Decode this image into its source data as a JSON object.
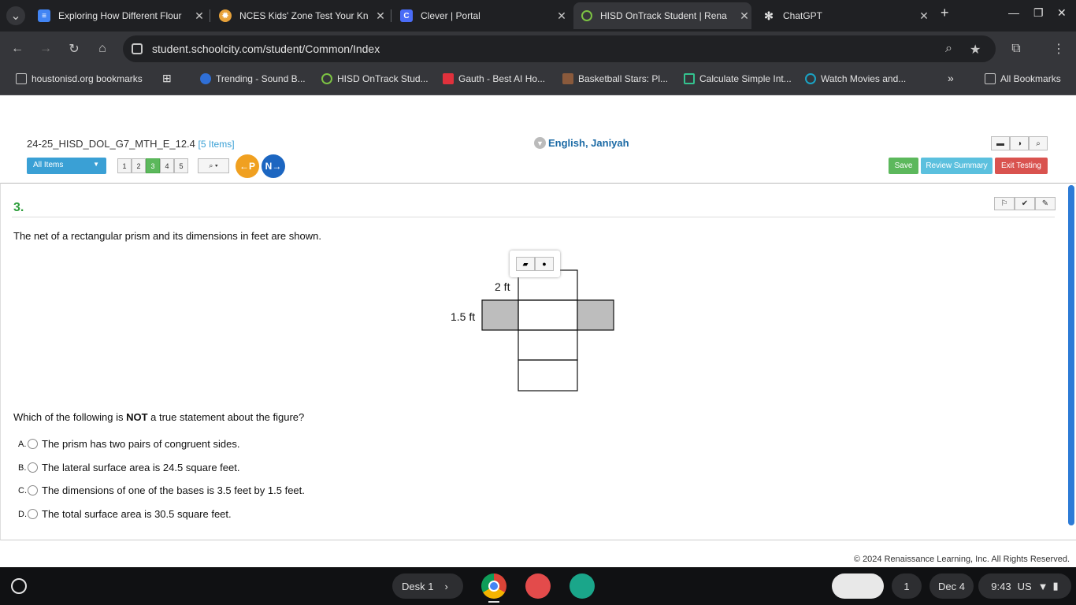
{
  "browser": {
    "tabs": [
      {
        "title": "Exploring How Different Flour",
        "icon": "google-docs-icon",
        "color": "#4285f4"
      },
      {
        "title": "NCES Kids' Zone Test Your Kn",
        "icon": "nces-sun-icon",
        "color": "#e8a23a"
      },
      {
        "title": "Clever | Portal",
        "icon": "clever-c-icon",
        "color": "#4a6cf7"
      },
      {
        "title": "HISD OnTrack Student | Rena",
        "icon": "ontrack-ring-icon",
        "color": "#7cc243"
      },
      {
        "title": "ChatGPT",
        "icon": "chatgpt-icon",
        "color": "#e3e3e3"
      }
    ],
    "active_tab_index": 3,
    "url": "student.schoolcity.com/student/Common/Index",
    "bookmarks": [
      {
        "label": "houstonisd.org bookmarks",
        "icon": "folder-icon"
      },
      {
        "label": "Trending - Sound B...",
        "icon": "globe-icon"
      },
      {
        "label": "HISD OnTrack Stud...",
        "icon": "ontrack-ring-icon"
      },
      {
        "label": "Gauth - Best AI Ho...",
        "icon": "gauth-icon"
      },
      {
        "label": "Basketball Stars: Pl...",
        "icon": "basketball-icon"
      },
      {
        "label": "Calculate Simple Int...",
        "icon": "calculator-icon"
      },
      {
        "label": "Watch Movies and...",
        "icon": "globe-icon"
      }
    ],
    "all_bookmarks": "All Bookmarks",
    "more_bookmarks": "»"
  },
  "test": {
    "name": "24-25_HISD_DOL_G7_MTH_E_12.4",
    "items_count": "[5 Items]",
    "student_name": "English, Janiyah",
    "all_items_label": "All Items",
    "question_numbers": [
      "1",
      "2",
      "3",
      "4",
      "5"
    ],
    "current_question": "3",
    "prev_label": "P",
    "next_label": "N",
    "save_label": "Save",
    "review_label": "Review Summary",
    "exit_label": "Exit Testing"
  },
  "question": {
    "number": "3.",
    "stem": "The net of a rectangular prism and its dimensions in feet are shown.",
    "figure": {
      "label_top": "2 ft",
      "label_left": "1.5 ft"
    },
    "ask_pre": "Which of the following is ",
    "ask_bold": "NOT",
    "ask_post": " a true statement about the figure?",
    "choices": [
      {
        "letter": "A.",
        "text": "The prism has two pairs of congruent sides."
      },
      {
        "letter": "B.",
        "text": "The lateral surface area is 24.5 square feet."
      },
      {
        "letter": "C.",
        "text": "The dimensions of one of the bases is 3.5 feet by 1.5 feet."
      },
      {
        "letter": "D.",
        "text": "The total surface area is 30.5 square feet."
      }
    ]
  },
  "footer": {
    "copyright": "© 2024 Renaissance Learning, Inc. All Rights Reserved."
  },
  "shelf": {
    "desk_label": "Desk 1",
    "notification_count": "1",
    "date": "Dec 4",
    "time": "9:43",
    "locale": "US"
  }
}
